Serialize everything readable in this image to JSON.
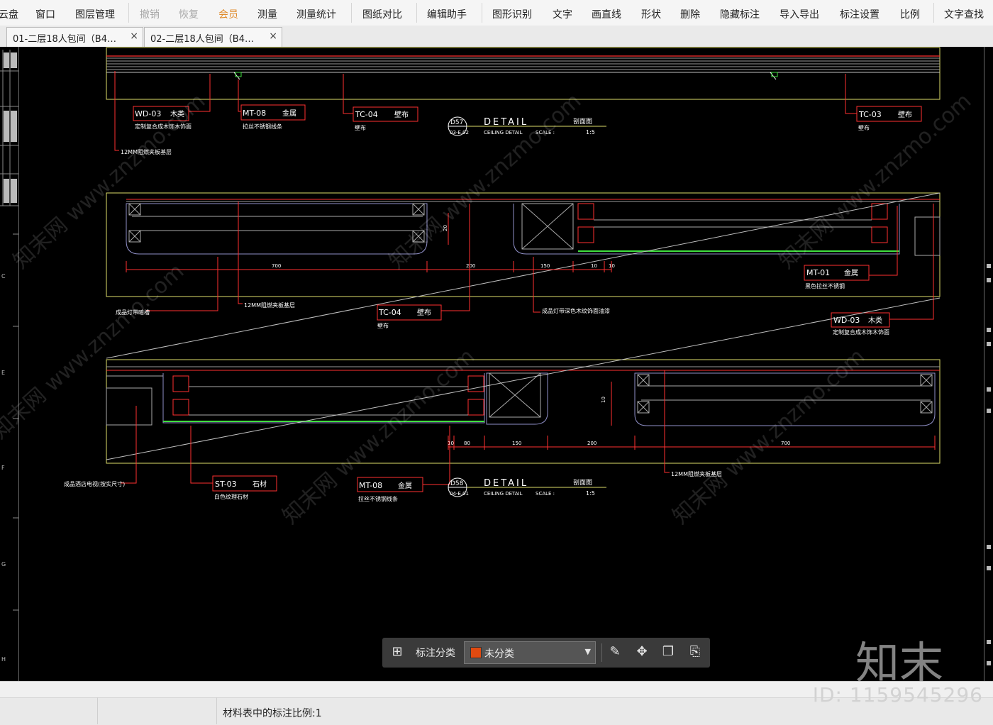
{
  "toolbar": {
    "items": [
      {
        "label": "云盘",
        "state": "normal"
      },
      {
        "label": "窗口",
        "state": "normal"
      },
      {
        "label": "图层管理",
        "state": "normal"
      },
      {
        "label": "撤销",
        "state": "disabled"
      },
      {
        "label": "恢复",
        "state": "disabled"
      },
      {
        "label": "会员",
        "state": "member"
      },
      {
        "label": "测量",
        "state": "normal"
      },
      {
        "label": "测量统计",
        "state": "normal"
      },
      {
        "label": "图纸对比",
        "state": "normal"
      },
      {
        "label": "编辑助手",
        "state": "normal"
      },
      {
        "label": "图形识别",
        "state": "normal"
      },
      {
        "label": "文字",
        "state": "normal"
      },
      {
        "label": "画直线",
        "state": "normal"
      },
      {
        "label": "形状",
        "state": "normal"
      },
      {
        "label": "删除",
        "state": "normal"
      },
      {
        "label": "隐藏标注",
        "state": "normal"
      },
      {
        "label": "导入导出",
        "state": "normal"
      },
      {
        "label": "标注设置",
        "state": "normal"
      },
      {
        "label": "比例",
        "state": "normal"
      },
      {
        "label": "文字查找",
        "state": "normal"
      }
    ]
  },
  "tabs": [
    {
      "label": "01-二层18人包间（B4…",
      "close": "×"
    },
    {
      "label": "02-二层18人包间（B4…",
      "close": "×"
    }
  ],
  "drawing": {
    "detail1": {
      "number": "D57",
      "sheet": "03-E.02",
      "title": "DETAIL",
      "title_cn": "剖面图",
      "subtitle": "CEILING DETAIL",
      "scale_label": "SCALE :",
      "scale": "1:5"
    },
    "detail2": {
      "number": "D58",
      "sheet": "04-E.01",
      "title": "DETAIL",
      "title_cn": "剖面图",
      "subtitle": "CEILING DETAIL",
      "scale_label": "SCALE :",
      "scale": "1:5"
    },
    "tags": {
      "wd03_top": {
        "code": "WD-03",
        "mat": "木类",
        "note": "定制复合成木饰木饰面"
      },
      "mt08_top": {
        "code": "MT-08",
        "mat": "金属",
        "note": "拉丝不锈钢线条"
      },
      "tc04_top": {
        "code": "TC-04",
        "mat": "壁布",
        "note": "壁布"
      },
      "tc03_top": {
        "code": "TC-03",
        "mat": "壁布",
        "note": "壁布"
      },
      "board_top": "12MM阻燃夹板基层",
      "led_mid": "成品灯带暗槽",
      "board_mid": "12MM阻燃夹板基层",
      "tc04_mid": {
        "code": "TC-04",
        "mat": "壁布",
        "note": "壁布"
      },
      "paint_mid": "成品灯带深色木纹饰面油漆",
      "mt01_mid": {
        "code": "MT-01",
        "mat": "金属",
        "note": "黑色拉丝不锈钢"
      },
      "wd03_mid": {
        "code": "WD-03",
        "mat": "木类",
        "note": "定制复合成木饰木饰面"
      },
      "tv_bot": "成品酒店电视(按实尺寸)",
      "st03_bot": {
        "code": "ST-03",
        "mat": "石材",
        "note": "白色纹理石材"
      },
      "mt08_bot": {
        "code": "MT-08",
        "mat": "金属",
        "note": "拉丝不锈钢线条"
      },
      "board_bot": "12MM阻燃夹板基层"
    },
    "dims_mid": [
      "700",
      "200",
      "150",
      "10",
      "10",
      "20"
    ],
    "dims_bot": [
      "10",
      "80",
      "150",
      "200",
      "700",
      "10"
    ],
    "left_ruler": [
      "C",
      "E",
      "F",
      "G",
      "H"
    ]
  },
  "annotation_panel": {
    "label": "标注分类",
    "selected": "未分类",
    "swatch_color": "#e04a10"
  },
  "watermark": {
    "logo": "知末",
    "id": "ID: 1159545296",
    "site": "知末网 www.znzmo.com"
  },
  "status": {
    "text": "材料表中的标注比例:1"
  }
}
